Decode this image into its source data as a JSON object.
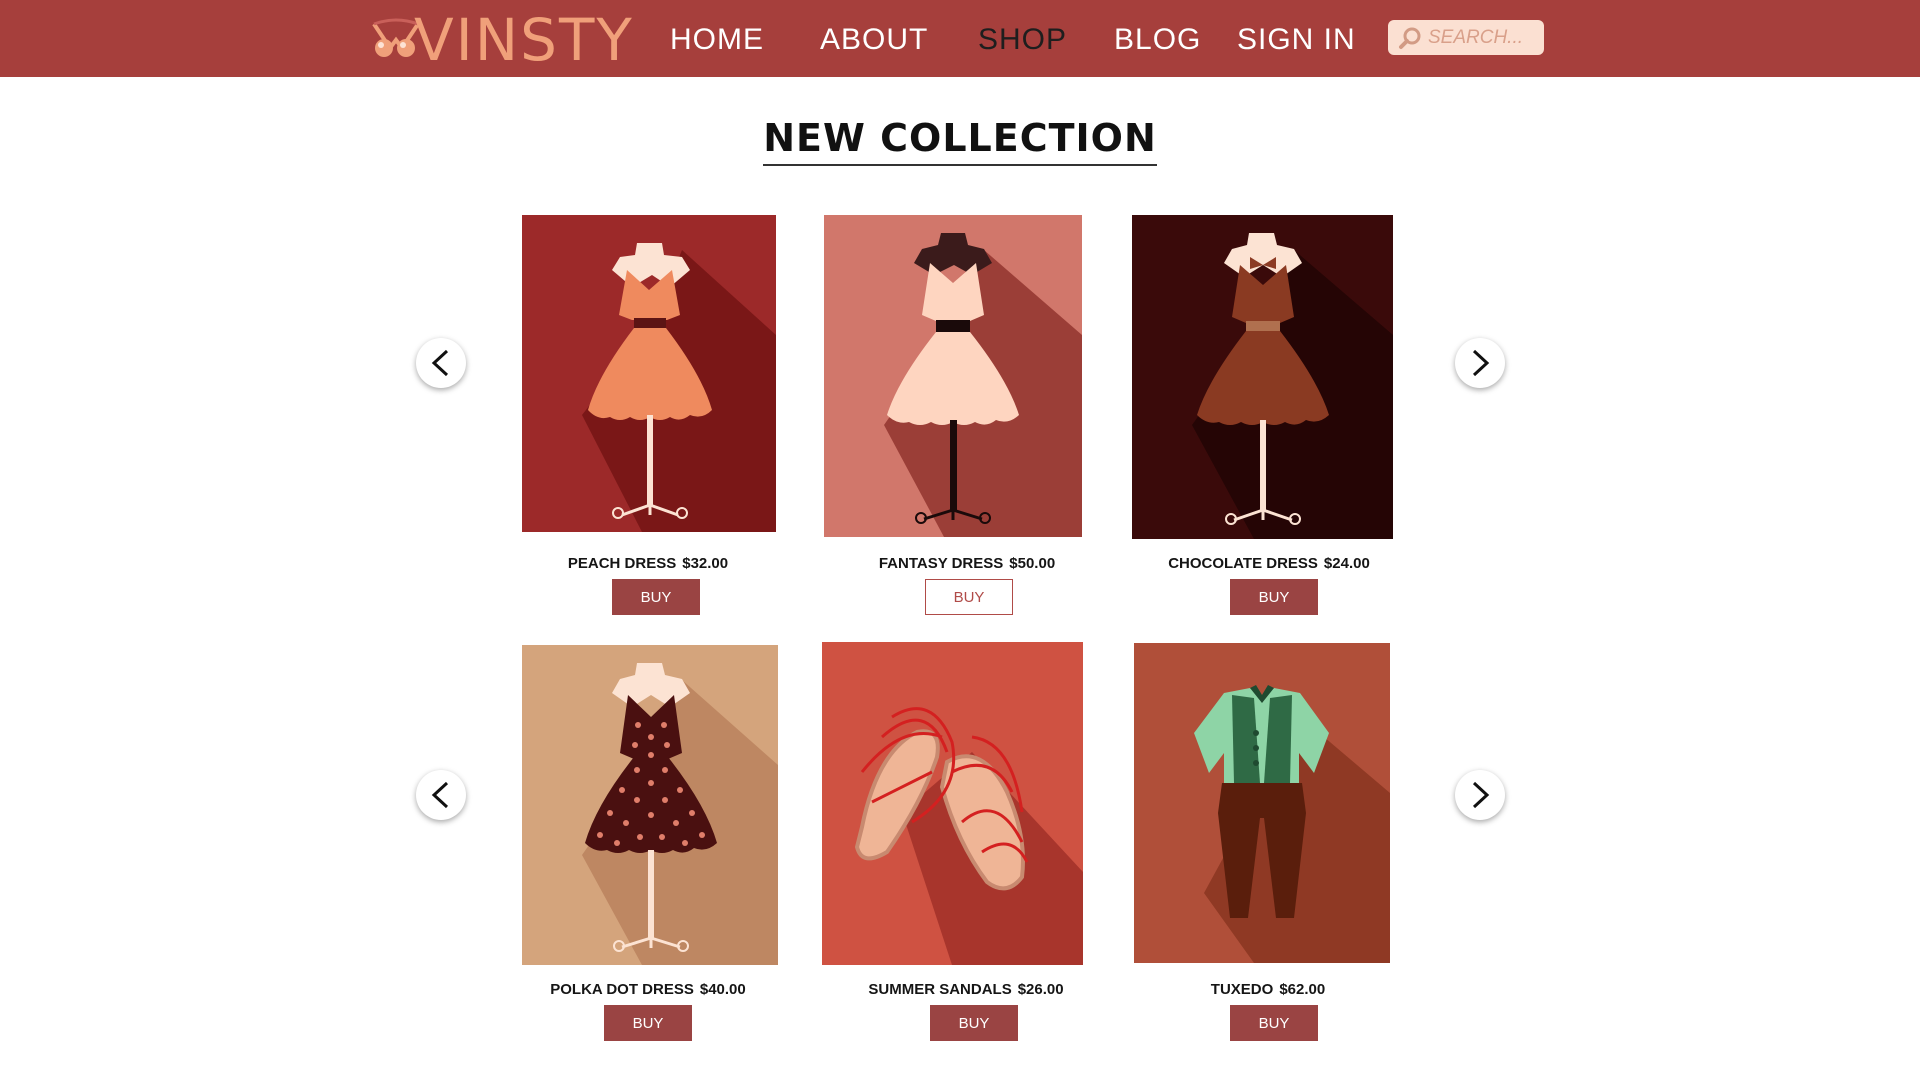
{
  "brand": {
    "name": "VINSTY"
  },
  "nav": {
    "items": [
      "HOME",
      "ABOUT",
      "SHOP",
      "BLOG",
      "SIGN IN"
    ],
    "active": "SHOP"
  },
  "search": {
    "placeholder": "SEARCH..."
  },
  "collection": {
    "title": "NEW COLLECTION",
    "products": [
      {
        "name": "PEACH DRESS",
        "price": "$32.00",
        "button": "BUY",
        "icon": "peach-dress-icon"
      },
      {
        "name": "FANTASY DRESS",
        "price": "$50.00",
        "button": "BUY",
        "icon": "fantasy-dress-icon"
      },
      {
        "name": "CHOCOLATE DRESS",
        "price": "$24.00",
        "button": "BUY",
        "icon": "chocolate-dress-icon"
      },
      {
        "name": "POLKA DOT DRESS",
        "price": "$40.00",
        "button": "BUY",
        "icon": "polka-dot-dress-icon"
      },
      {
        "name": "SUMMER SANDALS",
        "price": "$26.00",
        "button": "BUY",
        "icon": "sandals-icon"
      },
      {
        "name": "TUXEDO",
        "price": "$62.00",
        "button": "BUY",
        "icon": "tuxedo-icon"
      }
    ]
  },
  "colors": {
    "header": "#a63f3c",
    "button": "#9a4443",
    "logo": "#f0a07a"
  }
}
